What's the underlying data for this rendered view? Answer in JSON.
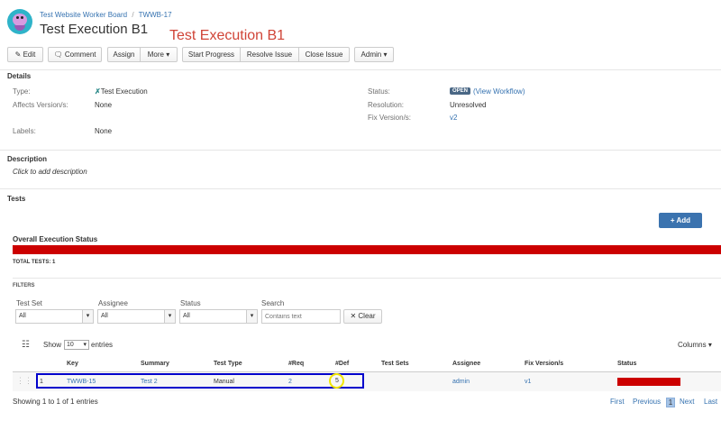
{
  "breadcrumb": {
    "project": "Test Website Worker Board",
    "separator": "/",
    "issue_key": "TWWB-17"
  },
  "issue_title": "Test Execution B1",
  "annotation_title": "Test Execution B1",
  "toolbar": {
    "edit": "Edit",
    "comment": "Comment",
    "assign": "Assign",
    "more": "More",
    "start_progress": "Start Progress",
    "resolve_issue": "Resolve Issue",
    "close_issue": "Close Issue",
    "admin": "Admin"
  },
  "details": {
    "heading": "Details",
    "type_label": "Type:",
    "type_value": "Test Execution",
    "affects_label": "Affects Version/s:",
    "affects_value": "None",
    "labels_label": "Labels:",
    "labels_value": "None",
    "status_label": "Status:",
    "status_badge": "OPEN",
    "status_link": "(View Workflow)",
    "resolution_label": "Resolution:",
    "resolution_value": "Unresolved",
    "fix_label": "Fix Version/s:",
    "fix_value": "v2"
  },
  "description": {
    "heading": "Description",
    "placeholder": "Click to add description"
  },
  "tests": {
    "heading": "Tests",
    "add_button": "Add",
    "overall_status": "Overall Execution Status",
    "total_tests": "TOTAL TESTS: 1",
    "progress_fail_fraction": 1.0
  },
  "filters": {
    "heading": "FILTERS",
    "test_set_label": "Test Set",
    "test_set_value": "All",
    "assignee_label": "Assignee",
    "assignee_value": "All",
    "status_label": "Status",
    "status_value": "All",
    "search_label": "Search",
    "search_placeholder": "Contains text",
    "clear_button": "Clear"
  },
  "table_controls": {
    "show_label": "Show",
    "entries_value": "10",
    "entries_label": "entries",
    "columns_button": "Columns"
  },
  "table": {
    "headers": [
      "Key",
      "Summary",
      "Test Type",
      "#Req",
      "#Def",
      "Test Sets",
      "Assignee",
      "Fix Version/s",
      "Status"
    ],
    "rows": [
      {
        "rank": "1",
        "key": "TWWB-15",
        "summary": "Test 2",
        "test_type": "Manual",
        "req": "2",
        "def": "5",
        "test_sets": "",
        "assignee": "admin",
        "fix_version": "v1",
        "status_color": "#d04437"
      }
    ]
  },
  "footer": {
    "showing": "Showing 1 to 1 of 1 entries",
    "first": "First",
    "previous": "Previous",
    "page": "1",
    "next": "Next",
    "last": "Last"
  },
  "colors": {
    "link": "#3572b0",
    "fail": "#cc0000",
    "highlight_box": "#0000cc",
    "highlight_circle": "#f2e600",
    "annotation": "#d04437"
  }
}
